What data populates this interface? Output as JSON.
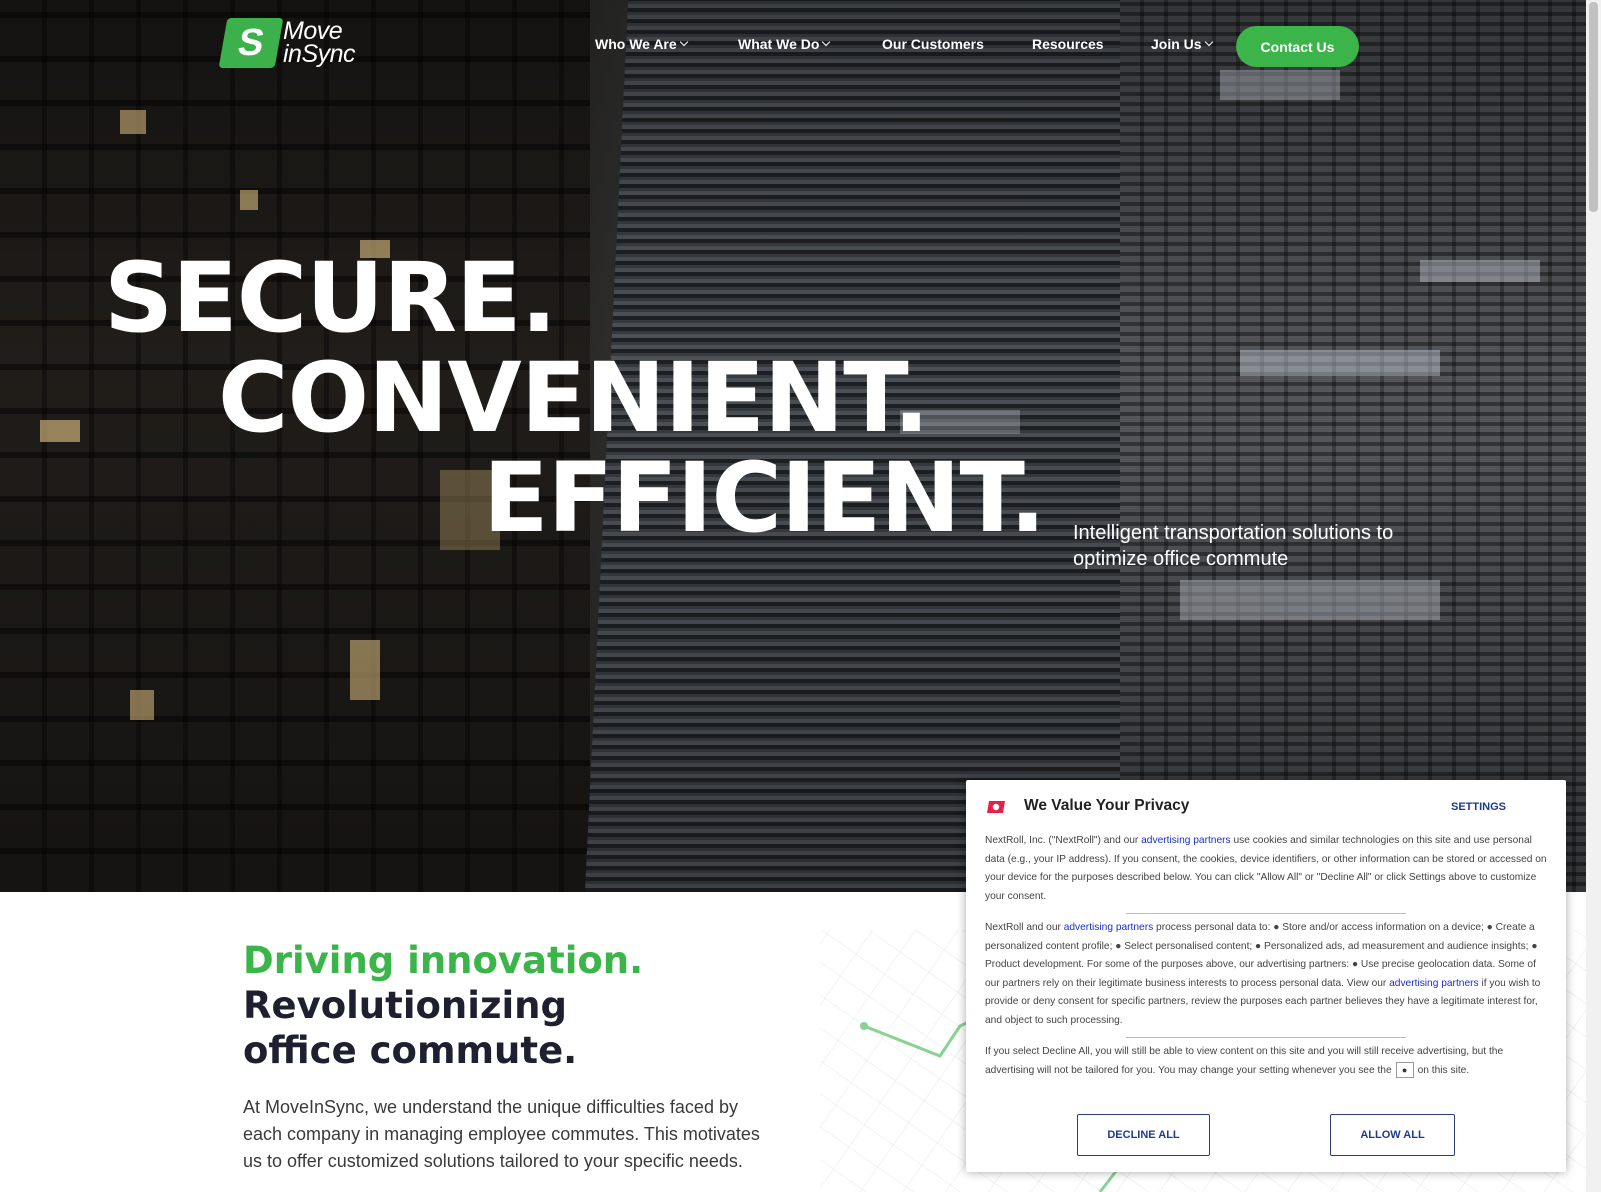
{
  "brand": {
    "name_line1": "Move",
    "name_line2": "inSync",
    "mark": "S",
    "color": "#3bb54a"
  },
  "nav": {
    "items": [
      {
        "label": "Who We Are",
        "has_dropdown": true
      },
      {
        "label": "What We Do",
        "has_dropdown": true
      },
      {
        "label": "Our Customers",
        "has_dropdown": false
      },
      {
        "label": "Resources",
        "has_dropdown": false
      },
      {
        "label": "Join Us",
        "has_dropdown": true
      }
    ],
    "cta": "Contact Us"
  },
  "hero": {
    "line1": "SECURE.",
    "line2": "CONVENIENT.",
    "line3": "EFFICIENT.",
    "subtitle": "Intelligent transportation solutions to optimize office commute"
  },
  "section": {
    "title_green": "Driving innovation.",
    "title_line2": "Revolutionizing",
    "title_line3": "office commute.",
    "body": "At MoveInSync, we understand the unique difficulties faced by each company in managing employee commutes. This motivates us to offer customized solutions tailored to your specific needs."
  },
  "consent": {
    "title": "We Value Your Privacy",
    "settings": "SETTINGS",
    "p1_a": "NextRoll, Inc. (\"NextRoll\") and our ",
    "p1_link": "advertising partners",
    "p1_b": " use cookies and similar technologies on this site and use personal data (e.g., your IP address). If you consent, the cookies, device identifiers, or other information can be stored or accessed on your device for the purposes described below. You can click \"Allow All\" or \"Decline All\" or click Settings above to customize your consent.",
    "p2_a": "NextRoll and our ",
    "p2_link": "advertising partners",
    "p2_b": " process personal data to: ● Store and/or access information on a device; ● Create a personalized content profile; ● Select personalised content; ● Personalized ads, ad measurement and audience insights; ● Product development. For some of the purposes above, our advertising partners: ● Use precise geolocation data. Some of our partners rely on their legitimate business interests to process personal data. View our ",
    "p2_link2": "advertising partners",
    "p2_c": " if you wish to provide or deny consent for specific partners, review the purposes each partner believes they have a legitimate interest for, and object to such processing.",
    "p3_a": "If you select Decline All, you will still be able to view content on this site and you will still receive advertising, but the advertising will not be tailored for you. You may change your setting whenever you see the",
    "p3_b": "on this site.",
    "decline": "DECLINE ALL",
    "allow": "ALLOW ALL"
  }
}
